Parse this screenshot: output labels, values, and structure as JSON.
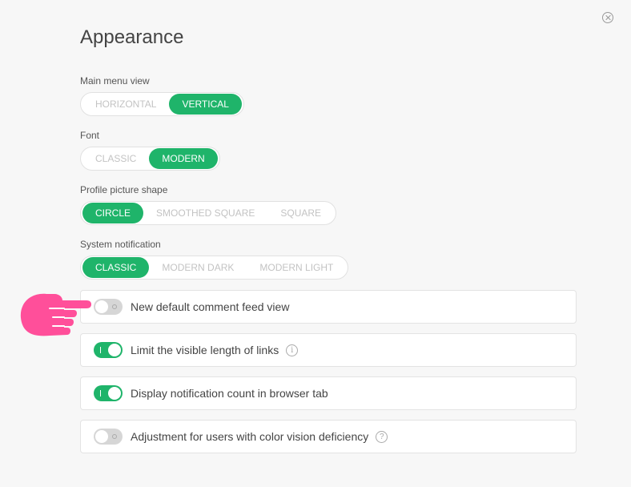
{
  "dialog": {
    "title": "Appearance",
    "close_icon": "close-circle-icon"
  },
  "groups": [
    {
      "label": "Main menu view",
      "options": [
        "HORIZONTAL",
        "VERTICAL"
      ],
      "selected": "VERTICAL"
    },
    {
      "label": "Font",
      "options": [
        "CLASSIC",
        "MODERN"
      ],
      "selected": "MODERN"
    },
    {
      "label": "Profile picture shape",
      "options": [
        "CIRCLE",
        "SMOOTHED SQUARE",
        "SQUARE"
      ],
      "selected": "CIRCLE"
    },
    {
      "label": "System notification",
      "options": [
        "CLASSIC",
        "MODERN DARK",
        "MODERN LIGHT"
      ],
      "selected": "CLASSIC"
    }
  ],
  "toggles": [
    {
      "label": "New default comment feed view",
      "on": false,
      "icon": null
    },
    {
      "label": "Limit the visible length of links",
      "on": true,
      "icon": "info-icon",
      "icon_glyph": "i"
    },
    {
      "label": "Display notification count in browser tab",
      "on": true,
      "icon": null
    },
    {
      "label": "Adjustment for users with color vision deficiency",
      "on": false,
      "icon": "help-icon",
      "icon_glyph": "?"
    }
  ],
  "colors": {
    "accent": "#1fb46a",
    "pointer_hand": "#ff4f9a",
    "background": "#f7f7f7"
  },
  "overlay": {
    "icon": "pointing-hand-icon"
  }
}
